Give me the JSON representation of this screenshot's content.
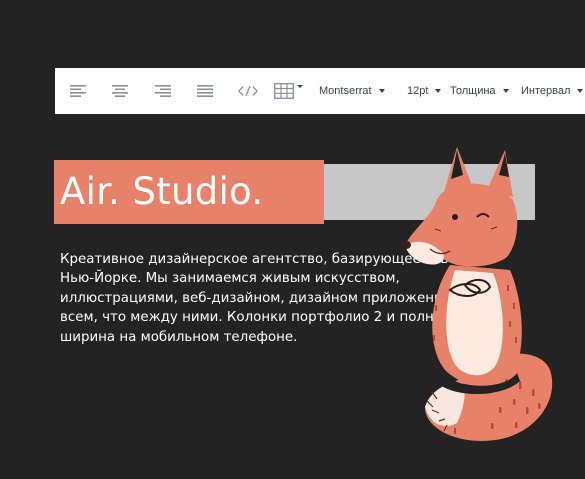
{
  "toolbar": {
    "align_left_label": "align-left",
    "align_center_label": "align-center",
    "align_right_label": "align-right",
    "align_justify_label": "align-justify",
    "code_label": "</>",
    "font_family": "Montserrat",
    "font_size": "12pt",
    "weight": "Толщина",
    "spacing": "Интервал"
  },
  "hero": {
    "title": "Air. Studio."
  },
  "description": {
    "lines": [
      "Креативное дизайнерское агентство, базирующееся в",
      "Нью-Йорке. Мы занимаемся живым искусством,",
      "иллюстрациями, веб-дизайном, дизайном приложений и",
      "всем, что между ними. Колонки портфолио 2 и полная",
      "ширина на мобильном телефоне."
    ]
  },
  "colors": {
    "background": "#232323",
    "accent": "#e8816a",
    "grey_bar": "#c7c7c7",
    "toolbar_bg": "#ffffff"
  },
  "icons": {
    "align_left": "align-left-icon",
    "align_center": "align-center-icon",
    "align_right": "align-right-icon",
    "align_justify": "align-justify-icon",
    "code": "code-icon",
    "table": "table-icon",
    "mascot": "fox-mascot-illustration"
  }
}
